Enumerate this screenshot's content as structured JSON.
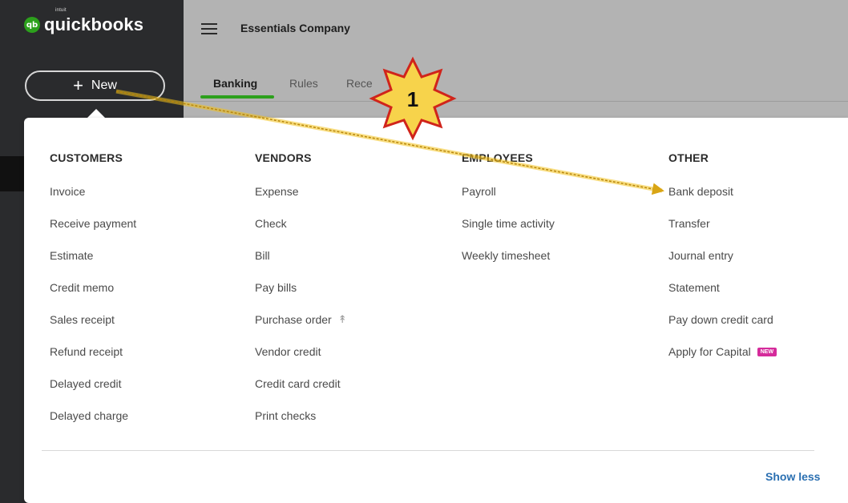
{
  "app": {
    "logo_text": "quickbooks",
    "logo_badge": "qb",
    "logo_intuit": "intuit",
    "new_button": "New",
    "new_icon": "plus-icon"
  },
  "header": {
    "company": "Essentials Company",
    "tabs": [
      {
        "label": "Banking",
        "active": true
      },
      {
        "label": "Rules",
        "active": false
      },
      {
        "label": "Rece",
        "active": false
      }
    ]
  },
  "menu": {
    "columns": [
      {
        "heading": "CUSTOMERS",
        "items": [
          "Invoice",
          "Receive payment",
          "Estimate",
          "Credit memo",
          "Sales receipt",
          "Refund receipt",
          "Delayed credit",
          "Delayed charge"
        ]
      },
      {
        "heading": "VENDORS",
        "items": [
          "Expense",
          "Check",
          "Bill",
          "Pay bills",
          "Purchase order",
          "Vendor credit",
          "Credit card credit",
          "Print checks"
        ]
      },
      {
        "heading": "EMPLOYEES",
        "items": [
          "Payroll",
          "Single time activity",
          "Weekly timesheet"
        ]
      },
      {
        "heading": "OTHER",
        "items": [
          "Bank deposit",
          "Transfer",
          "Journal entry",
          "Statement",
          "Pay down credit card",
          "Apply for Capital"
        ]
      }
    ],
    "new_badge": "NEW",
    "show_less": "Show less"
  },
  "annotation": {
    "step_number": "1",
    "color": "#f3c21a"
  },
  "colors": {
    "brand_green": "#2ca01c",
    "sidebar": "#2a2b2d",
    "link_blue": "#2a6fb1",
    "new_badge": "#d52b9b"
  }
}
